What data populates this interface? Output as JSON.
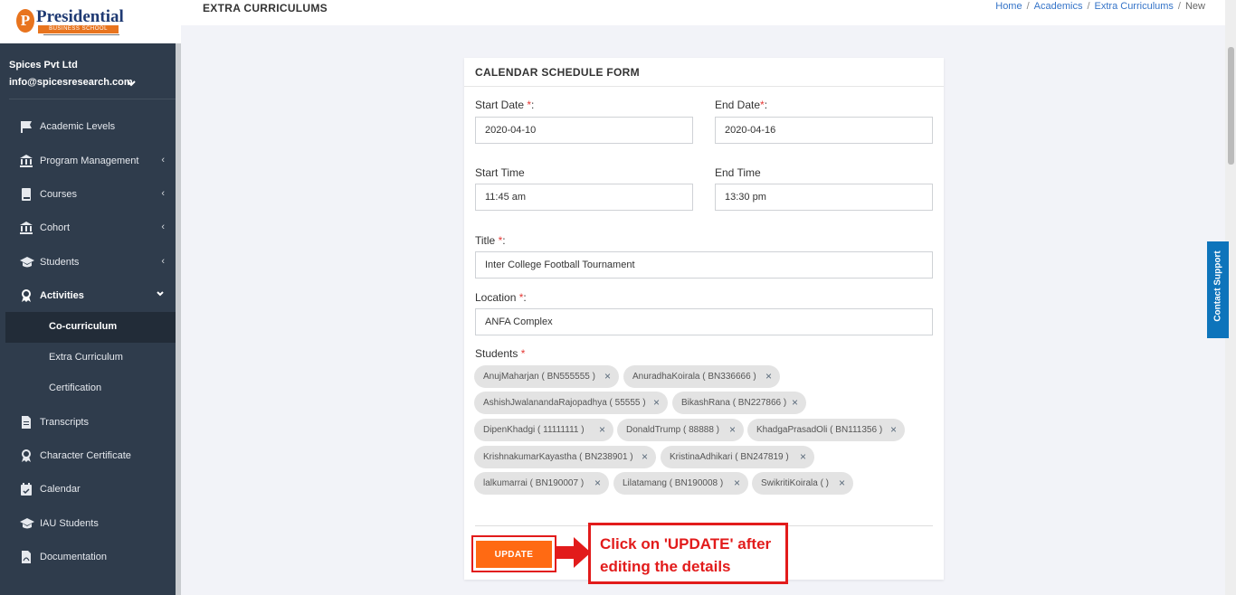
{
  "brand": {
    "logo_letter": "P",
    "logo_name": "Presidential",
    "logo_sub": "BUSINESS SCHOOL"
  },
  "user": {
    "company": "Spices Pvt Ltd",
    "email": "info@spicesresearch.com"
  },
  "sidebar": {
    "items": [
      {
        "label": "Academic Levels",
        "icon": "flag-icon"
      },
      {
        "label": "Program Management",
        "icon": "institution-icon",
        "chevron": "‹"
      },
      {
        "label": "Courses",
        "icon": "book-icon",
        "chevron": "‹"
      },
      {
        "label": "Cohort",
        "icon": "institution-icon",
        "chevron": "‹"
      },
      {
        "label": "Students",
        "icon": "graduation-cap-icon",
        "chevron": "‹"
      },
      {
        "label": "Activities",
        "icon": "award-icon",
        "chevron": "⌄"
      },
      {
        "label": "Transcripts",
        "icon": "document-icon"
      },
      {
        "label": "Character Certificate",
        "icon": "award-icon"
      },
      {
        "label": "Calendar",
        "icon": "calendar-check-icon"
      },
      {
        "label": "IAU Students",
        "icon": "graduation-cap-icon"
      },
      {
        "label": "Documentation",
        "icon": "pdf-file-icon"
      }
    ],
    "activities_sub": [
      "Co-curriculum",
      "Extra Curriculum",
      "Certification"
    ]
  },
  "header": {
    "title": "EXTRA CURRICULUMS",
    "breadcrumb": [
      "Home",
      "Academics",
      "Extra Curriculums",
      "New"
    ]
  },
  "contact_support": "Contact Support",
  "form": {
    "title": "CALENDAR SCHEDULE FORM",
    "start_date_label": "Start Date ",
    "start_date": "2020-04-10",
    "end_date_label": "End Date",
    "end_date": "2020-04-16",
    "start_time_label": "Start Time",
    "start_time": "11:45 am",
    "end_time_label": "End Time",
    "end_time": "13:30 pm",
    "title_label": "Title ",
    "title_value": "Inter College Football Tournament",
    "location_label": "Location ",
    "location_value": "ANFA Complex",
    "students_label": "Students ",
    "required_mark": "*",
    "colon": ":",
    "remove_glyph": "×",
    "students": [
      "AnujMaharjan ( BN555555 )",
      "AnuradhaKoirala ( BN336666 )",
      "AshishJwalanandaRajopadhya ( 55555 )",
      "BikashRana ( BN227866 )",
      "DipenKhadgi ( 11111111 )",
      "DonaldTrump ( 88888 )",
      "KhadgaPrasadOli ( BN111356 )",
      "KrishnakumarKayastha ( BN238901 )",
      "KristinaAdhikari ( BN247819 )",
      "lalkumarrai ( BN190007 )",
      "Lilatamang ( BN190008 )",
      "SwikritiKoirala ( )"
    ],
    "update_label": "UPDATE"
  },
  "annotation": {
    "text": "Click on 'UPDATE' after editing the details",
    "color": "#e21b1b"
  },
  "colors": {
    "sidebar": "#2f3c4c",
    "accent": "#ff6a13",
    "link": "#3574c8",
    "contact": "#0e74bb"
  }
}
